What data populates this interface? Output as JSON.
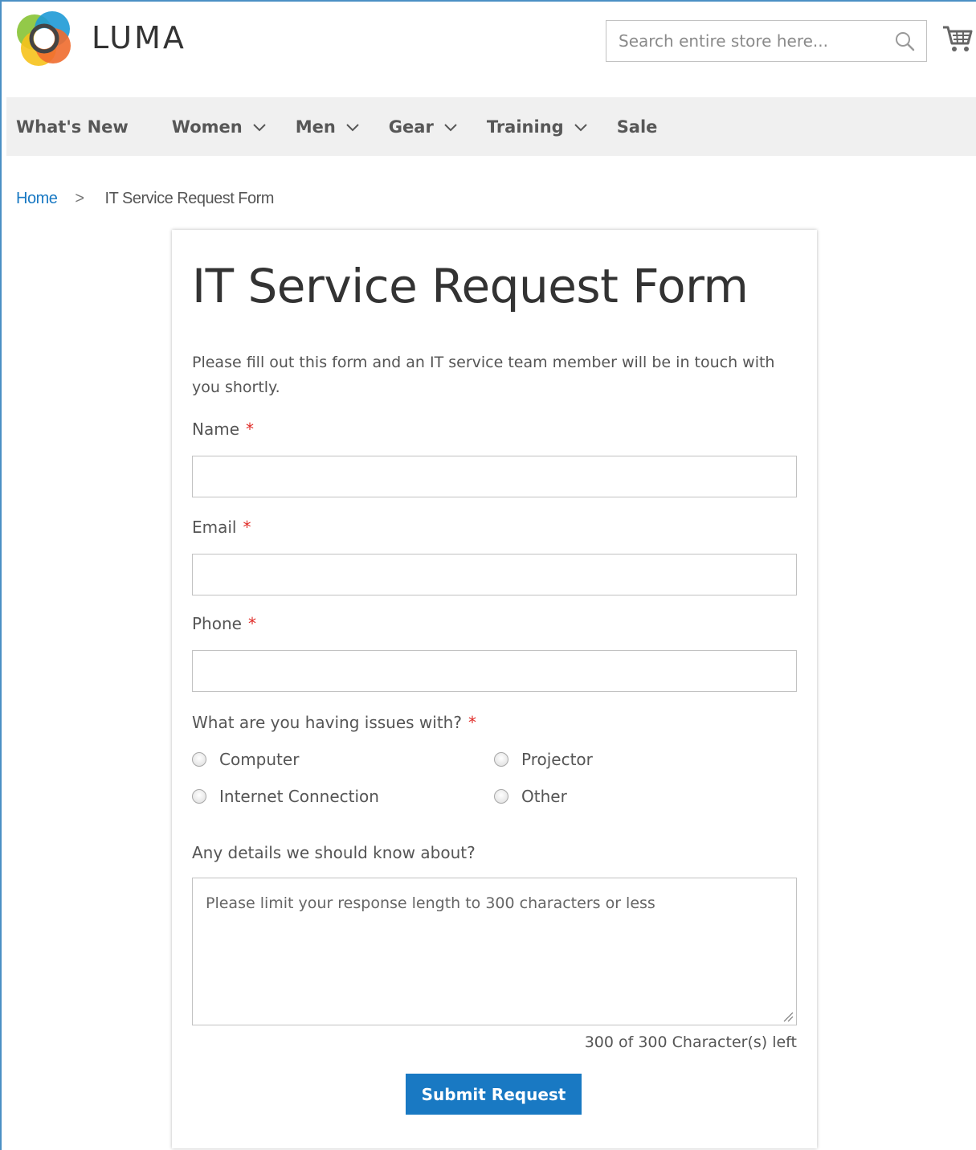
{
  "brand": {
    "name": "LUMA"
  },
  "search": {
    "placeholder": "Search entire store here...",
    "icon": "magnifier"
  },
  "cart": {
    "icon": "shopping-cart"
  },
  "nav": {
    "items": [
      {
        "label": "What's New",
        "has_dropdown": false
      },
      {
        "label": "Women",
        "has_dropdown": true
      },
      {
        "label": "Men",
        "has_dropdown": true
      },
      {
        "label": "Gear",
        "has_dropdown": true
      },
      {
        "label": "Training",
        "has_dropdown": true
      },
      {
        "label": "Sale",
        "has_dropdown": false
      }
    ]
  },
  "breadcrumb": {
    "home": "Home",
    "separator": ">",
    "current": "IT Service Request Form"
  },
  "form": {
    "title": "IT Service Request Form",
    "intro": "Please fill out this form and an IT service team member will be in touch with you shortly.",
    "required_mark": "*",
    "name": {
      "label": "Name",
      "value": ""
    },
    "email": {
      "label": "Email",
      "value": ""
    },
    "phone": {
      "label": "Phone",
      "value": ""
    },
    "issues": {
      "label": "What are you having issues with?",
      "options": [
        "Computer",
        "Projector",
        "Internet Connection",
        "Other"
      ]
    },
    "details": {
      "label": "Any details we should know about?",
      "placeholder": "Please limit your response length to 300 characters or less",
      "counter": "300 of 300 Character(s) left"
    },
    "submit_label": "Submit Request"
  },
  "colors": {
    "accent": "#1979c3",
    "required": "#e02b27",
    "nav_bg": "#f0f0f0"
  }
}
